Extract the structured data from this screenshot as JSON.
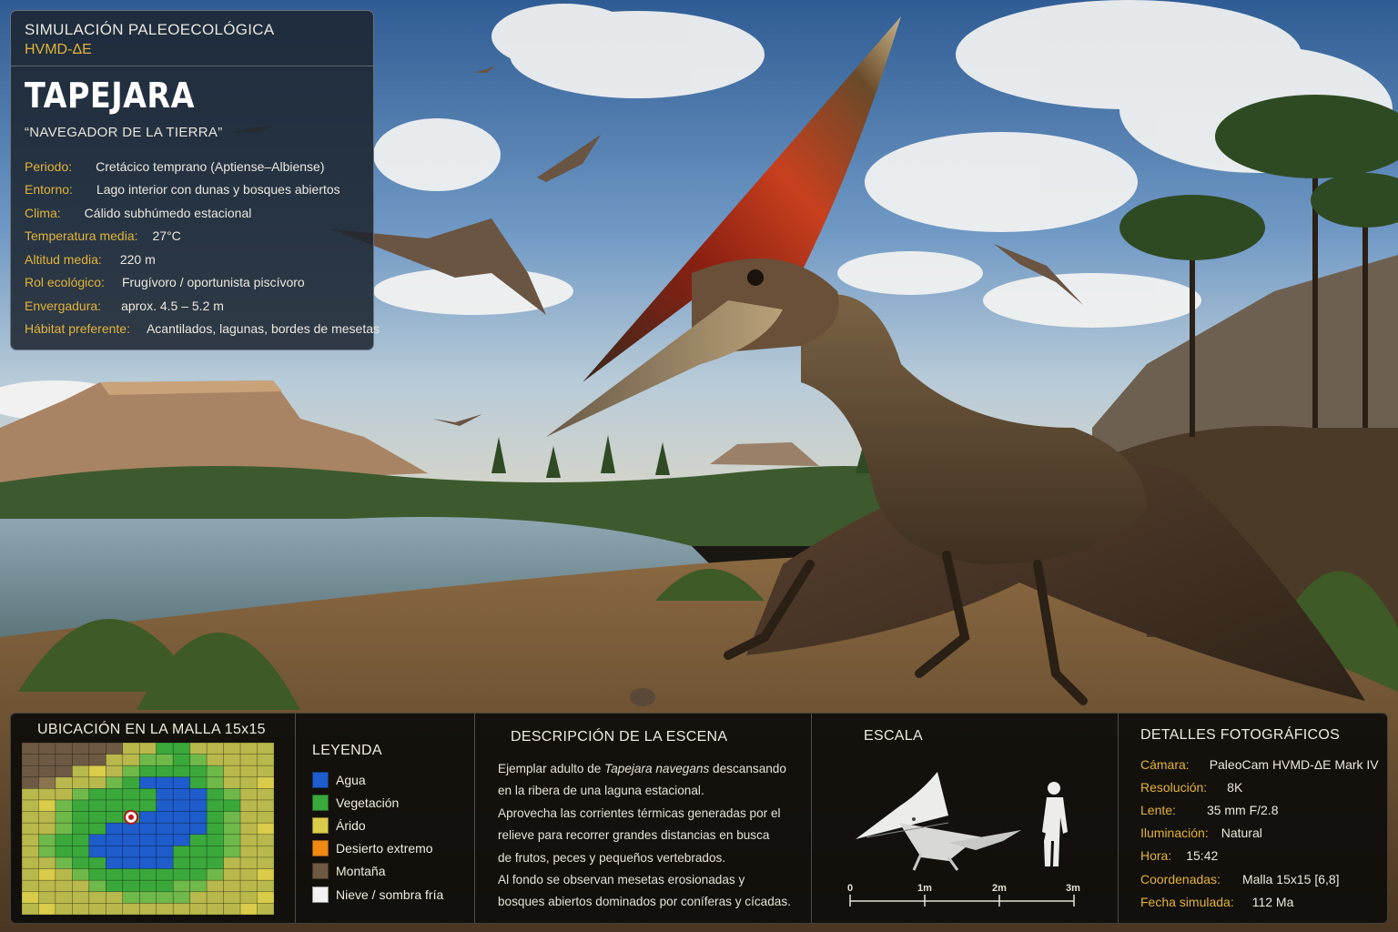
{
  "header": {
    "sim_label": "SIMULACIÓN PALEOECOLÓGICA",
    "sim_code": "HVMD-ΔE"
  },
  "species": {
    "name": "TAPEJARA",
    "nickname": "“NAVEGADOR DE LA TIERRA”"
  },
  "facts": [
    {
      "key": "Periodo:",
      "value": "Cretácico temprano (Aptiense–Albiense)"
    },
    {
      "key": "Entorno:",
      "value": "Lago interior con dunas y bosques abiertos"
    },
    {
      "key": "Clima:",
      "value": "Cálido subhúmedo estacional"
    },
    {
      "key": "Temperatura media:",
      "value": "27°C"
    },
    {
      "key": "Altitud media:",
      "value": "220 m"
    },
    {
      "key": "Rol ecológico:",
      "value": "Frugívoro / oportunista piscívoro"
    },
    {
      "key": "Envergadura:",
      "value": "aprox. 4.5 – 5.2 m"
    },
    {
      "key": "Hábitat preferente:",
      "value": "Acantilados, lagunas, bordes de mesetas"
    }
  ],
  "grid": {
    "title": "UBICACIÓN EN LA MALLA 15x15",
    "marker_cell": [
      6,
      8
    ]
  },
  "legend": {
    "title": "LEYENDA",
    "items": [
      {
        "label": "Agua",
        "color": "#1f5ccc"
      },
      {
        "label": "Vegetación",
        "color": "#3aa83a"
      },
      {
        "label": "Árido",
        "color": "#d8cc4a"
      },
      {
        "label": "Desierto extremo",
        "color": "#f08a14"
      },
      {
        "label": "Montaña",
        "color": "#6e5a44"
      },
      {
        "label": "Nieve / sombra fría",
        "color": "#f2f2f2"
      }
    ]
  },
  "description": {
    "title": "DESCRIPCIÓN DE LA ESCENA",
    "lead": "Ejemplar adulto de ",
    "italic": "Tapejara navegans",
    "lead_end": " descansando",
    "lines": [
      "en la ribera de una laguna estacional.",
      "Aprovecha las corrientes térmicas generadas por el",
      "relieve para recorrer grandes distancias en busca",
      "de frutos, peces y pequeños vertebrados.",
      "Al fondo se observan mesetas erosionadas y",
      "bosques abiertos dominados por coníferas y cícadas."
    ]
  },
  "scale": {
    "title": "ESCALA",
    "ticks": [
      "0",
      "1m",
      "2m",
      "3m"
    ]
  },
  "photo": {
    "title": "DETALLES FOTOGRÁFICOS",
    "rows": [
      {
        "key": "Cámara:",
        "value": "PaleoCam HVMD-ΔE Mark IV"
      },
      {
        "key": "Resolución:",
        "value": "8K"
      },
      {
        "key": "Lente:",
        "value": "35 mm F/2.8"
      },
      {
        "key": "Iluminación:",
        "value": "Natural"
      },
      {
        "key": "Hora:",
        "value": "15:42"
      },
      {
        "key": "Coordenadas:",
        "value": "Malla 15x15 [6,8]"
      },
      {
        "key": "Fecha simulada:",
        "value": "112 Ma"
      }
    ]
  }
}
